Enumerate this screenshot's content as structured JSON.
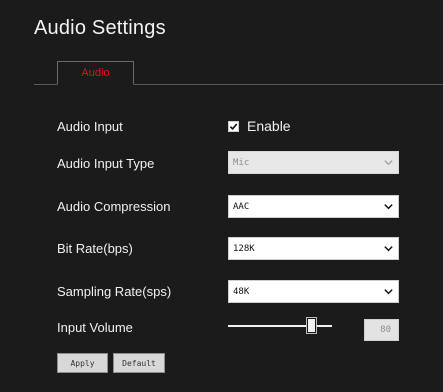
{
  "page": {
    "title": "Audio Settings"
  },
  "tabs": [
    {
      "label": "Audio",
      "active": true,
      "color": "#e3141b"
    }
  ],
  "form": {
    "audio_input": {
      "label": "Audio Input",
      "checked": true,
      "option_label": "Enable"
    },
    "audio_input_type": {
      "label": "Audio Input Type",
      "value": "Mic",
      "disabled": true
    },
    "audio_compression": {
      "label": "Audio Compression",
      "value": "AAC"
    },
    "bit_rate": {
      "label": "Bit Rate(bps)",
      "value": "128K"
    },
    "sampling_rate": {
      "label": "Sampling Rate(sps)",
      "value": "48K"
    },
    "input_volume": {
      "label": "Input Volume",
      "value": "80",
      "slider_level": 0.8
    }
  },
  "buttons": {
    "apply": "Apply",
    "default": "Default"
  },
  "icons": {
    "select_arrow": "chevron-down-icon",
    "checkbox_mark": "checkmark-icon"
  }
}
